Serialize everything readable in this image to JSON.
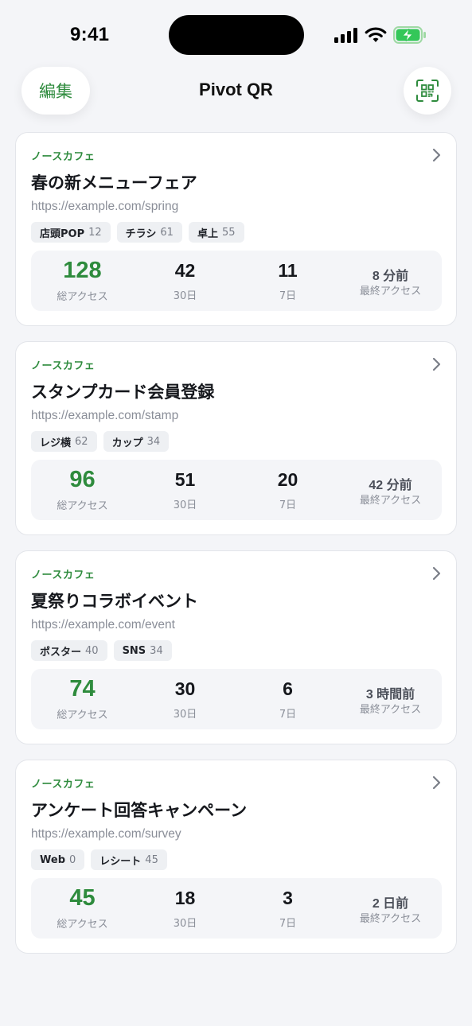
{
  "status_bar": {
    "time": "9:41"
  },
  "nav": {
    "edit_label": "編集",
    "title": "Pivot QR",
    "qr_icon": "qr-scan-icon"
  },
  "colors": {
    "accent": "#2e8b3d",
    "background": "#f4f5f8",
    "card": "#ffffff"
  },
  "cards": [
    {
      "owner": "ノースカフェ",
      "title": "春の新メニューフェア",
      "url": "https://example.com/spring",
      "tags": [
        {
          "name": "店頭POP",
          "count": "12"
        },
        {
          "name": "チラシ",
          "count": "61"
        },
        {
          "name": "卓上",
          "count": "55"
        }
      ],
      "stats": {
        "total": "128",
        "total_label": "総アクセス",
        "d30": "42",
        "d30_label": "30日",
        "d7": "11",
        "d7_label": "7日",
        "last": "8 分前",
        "last_label": "最終アクセス"
      }
    },
    {
      "owner": "ノースカフェ",
      "title": "スタンプカード会員登録",
      "url": "https://example.com/stamp",
      "tags": [
        {
          "name": "レジ横",
          "count": "62"
        },
        {
          "name": "カップ",
          "count": "34"
        }
      ],
      "stats": {
        "total": "96",
        "total_label": "総アクセス",
        "d30": "51",
        "d30_label": "30日",
        "d7": "20",
        "d7_label": "7日",
        "last": "42 分前",
        "last_label": "最終アクセス"
      }
    },
    {
      "owner": "ノースカフェ",
      "title": "夏祭りコラボイベント",
      "url": "https://example.com/event",
      "tags": [
        {
          "name": "ポスター",
          "count": "40"
        },
        {
          "name": "SNS",
          "count": "34"
        }
      ],
      "stats": {
        "total": "74",
        "total_label": "総アクセス",
        "d30": "30",
        "d30_label": "30日",
        "d7": "6",
        "d7_label": "7日",
        "last": "3 時間前",
        "last_label": "最終アクセス"
      }
    },
    {
      "owner": "ノースカフェ",
      "title": "アンケート回答キャンペーン",
      "url": "https://example.com/survey",
      "tags": [
        {
          "name": "Web",
          "count": "0"
        },
        {
          "name": "レシート",
          "count": "45"
        }
      ],
      "stats": {
        "total": "45",
        "total_label": "総アクセス",
        "d30": "18",
        "d30_label": "30日",
        "d7": "3",
        "d7_label": "7日",
        "last": "2 日前",
        "last_label": "最終アクセス"
      }
    }
  ]
}
